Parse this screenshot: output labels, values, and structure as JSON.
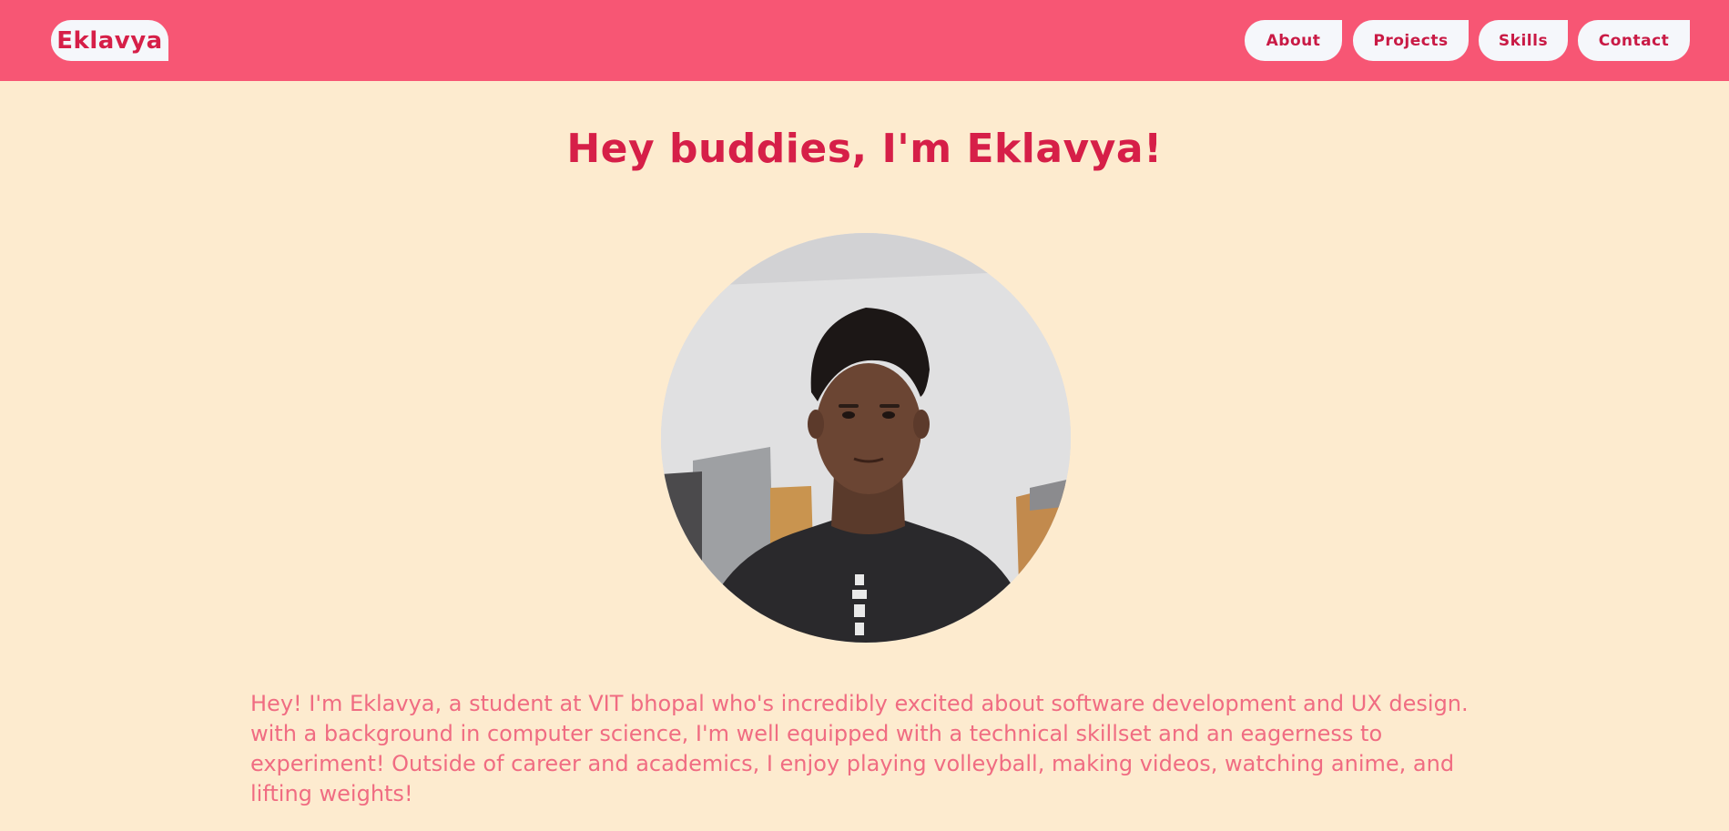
{
  "header": {
    "logo": "Eklavya",
    "nav": [
      {
        "label": "About"
      },
      {
        "label": "Projects"
      },
      {
        "label": "Skills"
      },
      {
        "label": "Contact"
      }
    ]
  },
  "hero": {
    "title": "Hey buddies, I'm Eklavya!",
    "bio": "Hey! I'm Eklavya, a student at VIT bhopal who's incredibly excited about software development and UX design. with a background in computer science, I'm well equipped with a technical skillset and an eagerness to experiment! Outside of career and academics, I enjoy playing volleyball, making videos, watching anime, and lifting weights!"
  },
  "colors": {
    "header_bg": "#f75674",
    "page_bg": "#fdebcf",
    "accent": "#d61f48",
    "bio_text": "#f06c82",
    "pill_bg": "#f5f7fb"
  }
}
